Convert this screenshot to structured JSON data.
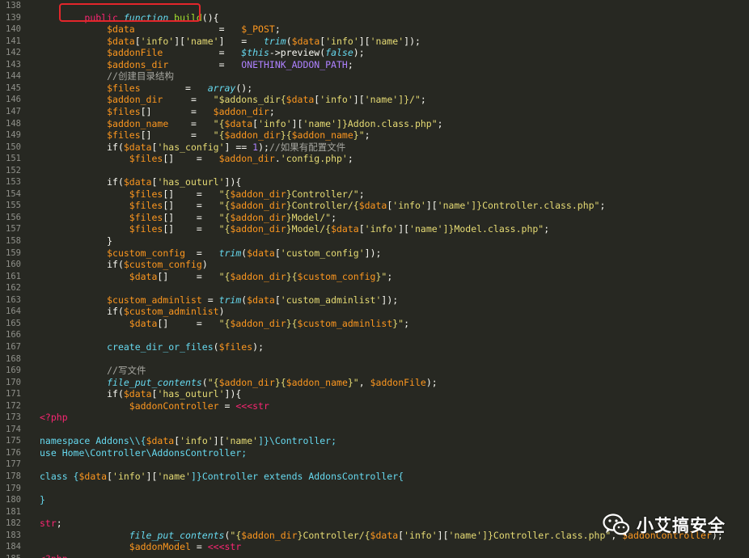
{
  "watermark": {
    "text": "小艾搞安全",
    "icon": "wechat-icon"
  },
  "colors": {
    "background": "#272822",
    "highlight_border": "#e3262b"
  },
  "lines": [
    {
      "n": "138",
      "t": []
    },
    {
      "n": "139",
      "t": [
        [
          "        ",
          ""
        ],
        [
          "public ",
          "kw"
        ],
        [
          "function ",
          "fn"
        ],
        [
          "build",
          "df"
        ],
        [
          "(){",
          ""
        ]
      ]
    },
    {
      "n": "140",
      "t": [
        [
          "            ",
          ""
        ],
        [
          "$data",
          "vr"
        ],
        [
          "               =   ",
          ""
        ],
        [
          "$_POST",
          "vr"
        ],
        [
          ";",
          ""
        ]
      ]
    },
    {
      "n": "141",
      "t": [
        [
          "            ",
          ""
        ],
        [
          "$data",
          "vr"
        ],
        [
          "[",
          ""
        ],
        [
          "'info'",
          "st"
        ],
        [
          "][",
          ""
        ],
        [
          "'name'",
          "st"
        ],
        [
          "]   =   ",
          ""
        ],
        [
          "trim",
          "fn"
        ],
        [
          "(",
          ""
        ],
        [
          "$data",
          "vr"
        ],
        [
          "[",
          ""
        ],
        [
          "'info'",
          "st"
        ],
        [
          "][",
          ""
        ],
        [
          "'name'",
          "st"
        ],
        [
          "]);",
          ""
        ]
      ]
    },
    {
      "n": "142",
      "t": [
        [
          "            ",
          ""
        ],
        [
          "$addonFile",
          "vr"
        ],
        [
          "          =   ",
          ""
        ],
        [
          "$this",
          "fn"
        ],
        [
          "->preview(",
          ""
        ],
        [
          "false",
          "fn"
        ],
        [
          ");",
          ""
        ]
      ]
    },
    {
      "n": "143",
      "t": [
        [
          "            ",
          ""
        ],
        [
          "$addons_dir",
          "vr"
        ],
        [
          "         =   ",
          ""
        ],
        [
          "ONETHINK_ADDON_PATH",
          "ct"
        ],
        [
          ";",
          ""
        ]
      ]
    },
    {
      "n": "144",
      "t": [
        [
          "            ",
          ""
        ],
        [
          "//创建目录结构",
          "cm"
        ]
      ]
    },
    {
      "n": "145",
      "t": [
        [
          "            ",
          ""
        ],
        [
          "$files",
          "vr"
        ],
        [
          "        =   ",
          ""
        ],
        [
          "array",
          "fn"
        ],
        [
          "();",
          ""
        ]
      ]
    },
    {
      "n": "146",
      "t": [
        [
          "            ",
          ""
        ],
        [
          "$addon_dir",
          "vr"
        ],
        [
          "     =   ",
          ""
        ],
        [
          "\"$addons_dir{",
          "st"
        ],
        [
          "$data",
          "vr"
        ],
        [
          "[",
          ""
        ],
        [
          "'info'",
          "st"
        ],
        [
          "][",
          ""
        ],
        [
          "'name'",
          "st"
        ],
        [
          "]}/\"",
          "st"
        ],
        [
          ";",
          ""
        ]
      ]
    },
    {
      "n": "147",
      "t": [
        [
          "            ",
          ""
        ],
        [
          "$files",
          "vr"
        ],
        [
          "[]       =   ",
          ""
        ],
        [
          "$addon_dir",
          "vr"
        ],
        [
          ";",
          ""
        ]
      ]
    },
    {
      "n": "148",
      "t": [
        [
          "            ",
          ""
        ],
        [
          "$addon_name",
          "vr"
        ],
        [
          "    =   ",
          ""
        ],
        [
          "\"{",
          "st"
        ],
        [
          "$data",
          "vr"
        ],
        [
          "[",
          ""
        ],
        [
          "'info'",
          "st"
        ],
        [
          "][",
          ""
        ],
        [
          "'name'",
          "st"
        ],
        [
          "]}Addon.class.php\"",
          "st"
        ],
        [
          ";",
          ""
        ]
      ]
    },
    {
      "n": "149",
      "t": [
        [
          "            ",
          ""
        ],
        [
          "$files",
          "vr"
        ],
        [
          "[]       =   ",
          ""
        ],
        [
          "\"{",
          "st"
        ],
        [
          "$addon_dir",
          "vr"
        ],
        [
          "}{",
          "st"
        ],
        [
          "$addon_name",
          "vr"
        ],
        [
          "}\"",
          "st"
        ],
        [
          ";",
          ""
        ]
      ]
    },
    {
      "n": "150",
      "t": [
        [
          "            ",
          ""
        ],
        [
          "if(",
          ""
        ],
        [
          "$data",
          "vr"
        ],
        [
          "[",
          ""
        ],
        [
          "'has_config'",
          "st"
        ],
        [
          "] == ",
          ""
        ],
        [
          "1",
          "ct"
        ],
        [
          ");",
          ""
        ],
        [
          "//如果有配置文件",
          "cm"
        ]
      ]
    },
    {
      "n": "151",
      "t": [
        [
          "                ",
          ""
        ],
        [
          "$files",
          "vr"
        ],
        [
          "[]    =   ",
          ""
        ],
        [
          "$addon_dir",
          "vr"
        ],
        [
          ".",
          ""
        ],
        [
          "'config.php'",
          "st"
        ],
        [
          ";",
          ""
        ]
      ]
    },
    {
      "n": "152",
      "t": []
    },
    {
      "n": "153",
      "t": [
        [
          "            ",
          ""
        ],
        [
          "if(",
          ""
        ],
        [
          "$data",
          "vr"
        ],
        [
          "[",
          ""
        ],
        [
          "'has_outurl'",
          "st"
        ],
        [
          "]){",
          ""
        ]
      ]
    },
    {
      "n": "154",
      "t": [
        [
          "                ",
          ""
        ],
        [
          "$files",
          "vr"
        ],
        [
          "[]    =   ",
          ""
        ],
        [
          "\"{",
          "st"
        ],
        [
          "$addon_dir",
          "vr"
        ],
        [
          "}Controller/\"",
          "st"
        ],
        [
          ";",
          ""
        ]
      ]
    },
    {
      "n": "155",
      "t": [
        [
          "                ",
          ""
        ],
        [
          "$files",
          "vr"
        ],
        [
          "[]    =   ",
          ""
        ],
        [
          "\"{",
          "st"
        ],
        [
          "$addon_dir",
          "vr"
        ],
        [
          "}Controller/{",
          "st"
        ],
        [
          "$data",
          "vr"
        ],
        [
          "[",
          ""
        ],
        [
          "'info'",
          "st"
        ],
        [
          "][",
          ""
        ],
        [
          "'name'",
          "st"
        ],
        [
          "]}Controller.class.php\"",
          "st"
        ],
        [
          ";",
          ""
        ]
      ]
    },
    {
      "n": "156",
      "t": [
        [
          "                ",
          ""
        ],
        [
          "$files",
          "vr"
        ],
        [
          "[]    =   ",
          ""
        ],
        [
          "\"{",
          "st"
        ],
        [
          "$addon_dir",
          "vr"
        ],
        [
          "}Model/\"",
          "st"
        ],
        [
          ";",
          ""
        ]
      ]
    },
    {
      "n": "157",
      "t": [
        [
          "                ",
          ""
        ],
        [
          "$files",
          "vr"
        ],
        [
          "[]    =   ",
          ""
        ],
        [
          "\"{",
          "st"
        ],
        [
          "$addon_dir",
          "vr"
        ],
        [
          "}Model/{",
          "st"
        ],
        [
          "$data",
          "vr"
        ],
        [
          "[",
          ""
        ],
        [
          "'info'",
          "st"
        ],
        [
          "][",
          ""
        ],
        [
          "'name'",
          "st"
        ],
        [
          "]}Model.class.php\"",
          "st"
        ],
        [
          ";",
          ""
        ]
      ]
    },
    {
      "n": "158",
      "t": [
        [
          "            }",
          ""
        ]
      ]
    },
    {
      "n": "159",
      "t": [
        [
          "            ",
          ""
        ],
        [
          "$custom_config",
          "vr"
        ],
        [
          "  =   ",
          ""
        ],
        [
          "trim",
          "fn"
        ],
        [
          "(",
          ""
        ],
        [
          "$data",
          "vr"
        ],
        [
          "[",
          ""
        ],
        [
          "'custom_config'",
          "st"
        ],
        [
          "]);",
          ""
        ]
      ]
    },
    {
      "n": "160",
      "t": [
        [
          "            ",
          ""
        ],
        [
          "if(",
          ""
        ],
        [
          "$custom_config",
          "vr"
        ],
        [
          ")",
          ""
        ]
      ]
    },
    {
      "n": "161",
      "t": [
        [
          "                ",
          ""
        ],
        [
          "$data",
          "vr"
        ],
        [
          "[]     =   ",
          ""
        ],
        [
          "\"{",
          "st"
        ],
        [
          "$addon_dir",
          "vr"
        ],
        [
          "}{",
          "st"
        ],
        [
          "$custom_config",
          "vr"
        ],
        [
          "}\"",
          "st"
        ],
        [
          ";",
          ""
        ]
      ]
    },
    {
      "n": "162",
      "t": []
    },
    {
      "n": "163",
      "t": [
        [
          "            ",
          ""
        ],
        [
          "$custom_adminlist",
          "vr"
        ],
        [
          " = ",
          ""
        ],
        [
          "trim",
          "fn"
        ],
        [
          "(",
          ""
        ],
        [
          "$data",
          "vr"
        ],
        [
          "[",
          ""
        ],
        [
          "'custom_adminlist'",
          "st"
        ],
        [
          "]);",
          ""
        ]
      ]
    },
    {
      "n": "164",
      "t": [
        [
          "            ",
          ""
        ],
        [
          "if(",
          ""
        ],
        [
          "$custom_adminlist",
          "vr"
        ],
        [
          ")",
          ""
        ]
      ]
    },
    {
      "n": "165",
      "t": [
        [
          "                ",
          ""
        ],
        [
          "$data",
          "vr"
        ],
        [
          "[]     =   ",
          ""
        ],
        [
          "\"{",
          "st"
        ],
        [
          "$addon_dir",
          "vr"
        ],
        [
          "}{",
          "st"
        ],
        [
          "$custom_adminlist",
          "vr"
        ],
        [
          "}\"",
          "st"
        ],
        [
          ";",
          ""
        ]
      ]
    },
    {
      "n": "166",
      "t": []
    },
    {
      "n": "167",
      "t": [
        [
          "            ",
          ""
        ],
        [
          "create_dir_or_files",
          "bl"
        ],
        [
          "(",
          ""
        ],
        [
          "$files",
          "vr"
        ],
        [
          ");",
          ""
        ]
      ]
    },
    {
      "n": "168",
      "t": []
    },
    {
      "n": "169",
      "t": [
        [
          "            ",
          ""
        ],
        [
          "//写文件",
          "cm"
        ]
      ]
    },
    {
      "n": "170",
      "t": [
        [
          "            ",
          ""
        ],
        [
          "file_put_contents",
          "fn"
        ],
        [
          "(",
          ""
        ],
        [
          "\"{",
          "st"
        ],
        [
          "$addon_dir",
          "vr"
        ],
        [
          "}{",
          "st"
        ],
        [
          "$addon_name",
          "vr"
        ],
        [
          "}\"",
          "st"
        ],
        [
          ", ",
          ""
        ],
        [
          "$addonFile",
          "vr"
        ],
        [
          ");",
          ""
        ]
      ]
    },
    {
      "n": "171",
      "t": [
        [
          "            ",
          ""
        ],
        [
          "if(",
          ""
        ],
        [
          "$data",
          "vr"
        ],
        [
          "[",
          ""
        ],
        [
          "'has_outurl'",
          "st"
        ],
        [
          "]){",
          ""
        ]
      ]
    },
    {
      "n": "172",
      "t": [
        [
          "                ",
          ""
        ],
        [
          "$addonController",
          "vr"
        ],
        [
          " = ",
          ""
        ],
        [
          "<<<str",
          "kw"
        ]
      ]
    },
    {
      "n": "173",
      "t": [
        [
          "<?php",
          "kw"
        ]
      ]
    },
    {
      "n": "174",
      "t": []
    },
    {
      "n": "175",
      "t": [
        [
          "namespace Addons\\\\{",
          "bl"
        ],
        [
          "$data",
          "vr"
        ],
        [
          "[",
          ""
        ],
        [
          "'info'",
          "st"
        ],
        [
          "][",
          ""
        ],
        [
          "'name'",
          "st"
        ],
        [
          "]}\\Controller;",
          "bl"
        ]
      ]
    },
    {
      "n": "176",
      "t": [
        [
          "use Home\\Controller\\AddonsController;",
          "bl"
        ]
      ]
    },
    {
      "n": "177",
      "t": []
    },
    {
      "n": "178",
      "t": [
        [
          "class {",
          "bl"
        ],
        [
          "$data",
          "vr"
        ],
        [
          "[",
          ""
        ],
        [
          "'info'",
          "st"
        ],
        [
          "][",
          ""
        ],
        [
          "'name'",
          "st"
        ],
        [
          "]}Controller extends AddonsController{",
          "bl"
        ]
      ]
    },
    {
      "n": "179",
      "t": []
    },
    {
      "n": "180",
      "t": [
        [
          "}",
          "bl"
        ]
      ]
    },
    {
      "n": "181",
      "t": []
    },
    {
      "n": "182",
      "t": [
        [
          "str",
          "kw"
        ],
        [
          ";",
          ""
        ]
      ]
    },
    {
      "n": "183",
      "t": [
        [
          "                ",
          ""
        ],
        [
          "file_put_contents",
          "fn"
        ],
        [
          "(",
          ""
        ],
        [
          "\"{",
          "st"
        ],
        [
          "$addon_dir",
          "vr"
        ],
        [
          "}Controller/{",
          "st"
        ],
        [
          "$data",
          "vr"
        ],
        [
          "[",
          ""
        ],
        [
          "'info'",
          "st"
        ],
        [
          "][",
          ""
        ],
        [
          "'name'",
          "st"
        ],
        [
          "]}Controller.class.php\"",
          "st"
        ],
        [
          ", ",
          ""
        ],
        [
          "$addonController",
          "vr"
        ],
        [
          ");",
          ""
        ]
      ]
    },
    {
      "n": "184",
      "t": [
        [
          "                ",
          ""
        ],
        [
          "$addonModel",
          "vr"
        ],
        [
          " = ",
          ""
        ],
        [
          "<<<str",
          "kw"
        ]
      ]
    },
    {
      "n": "185",
      "t": [
        [
          "<?php",
          "kw"
        ]
      ]
    }
  ]
}
